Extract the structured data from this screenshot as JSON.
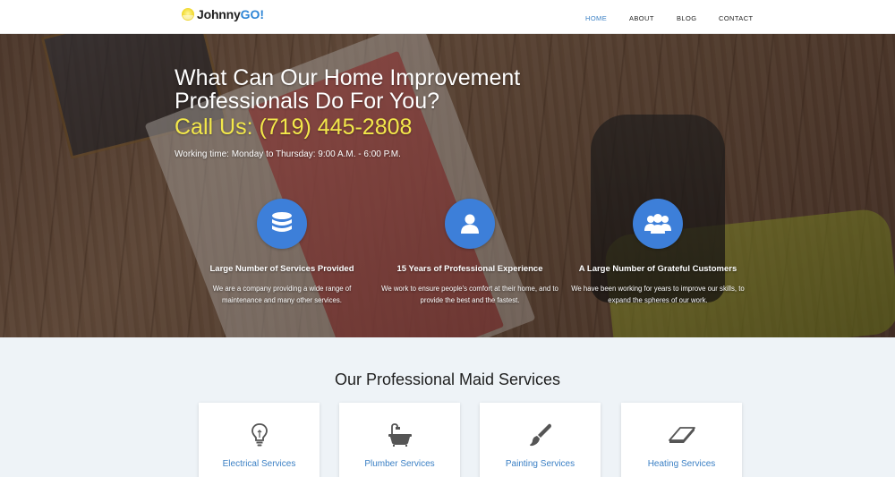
{
  "brand": {
    "name_main": "Johnny",
    "name_accent": "GO!"
  },
  "nav": {
    "items": [
      {
        "label": "HOME",
        "active": true
      },
      {
        "label": "ABOUT",
        "active": false
      },
      {
        "label": "BLOG",
        "active": false
      },
      {
        "label": "CONTACT",
        "active": false
      }
    ]
  },
  "hero": {
    "title": "What Can Our Home Improvement Professionals Do For You?",
    "phone": "Call Us: (719) 445-2808",
    "hours": "Working time: Monday to Thursday: 9:00 A.M. - 6:00 P.M."
  },
  "features": [
    {
      "icon": "database-icon",
      "title": "Large Number of Services Provided",
      "text": "We are a company providing a wide range of maintenance and many other services."
    },
    {
      "icon": "user-icon",
      "title": "15 Years of Professional Experience",
      "text": "We work to ensure people's comfort at their home, and to provide the best and the fastest."
    },
    {
      "icon": "users-icon",
      "title": "A Large Number of Grateful Customers",
      "text": "We have been working for years to improve our skills, to expand the spheres of our work."
    }
  ],
  "services": {
    "title": "Our Professional Maid Services",
    "items": [
      {
        "icon": "lightbulb-icon",
        "label": "Electrical Services"
      },
      {
        "icon": "bathtub-icon",
        "label": "Plumber Services"
      },
      {
        "icon": "paintbrush-icon",
        "label": "Painting Services"
      },
      {
        "icon": "eraser-icon",
        "label": "Heating Services"
      }
    ]
  },
  "colors": {
    "accent": "#3d7fd9",
    "link": "#3a7fc4",
    "phone": "#f3e84a",
    "services_bg": "#eef3f7"
  }
}
